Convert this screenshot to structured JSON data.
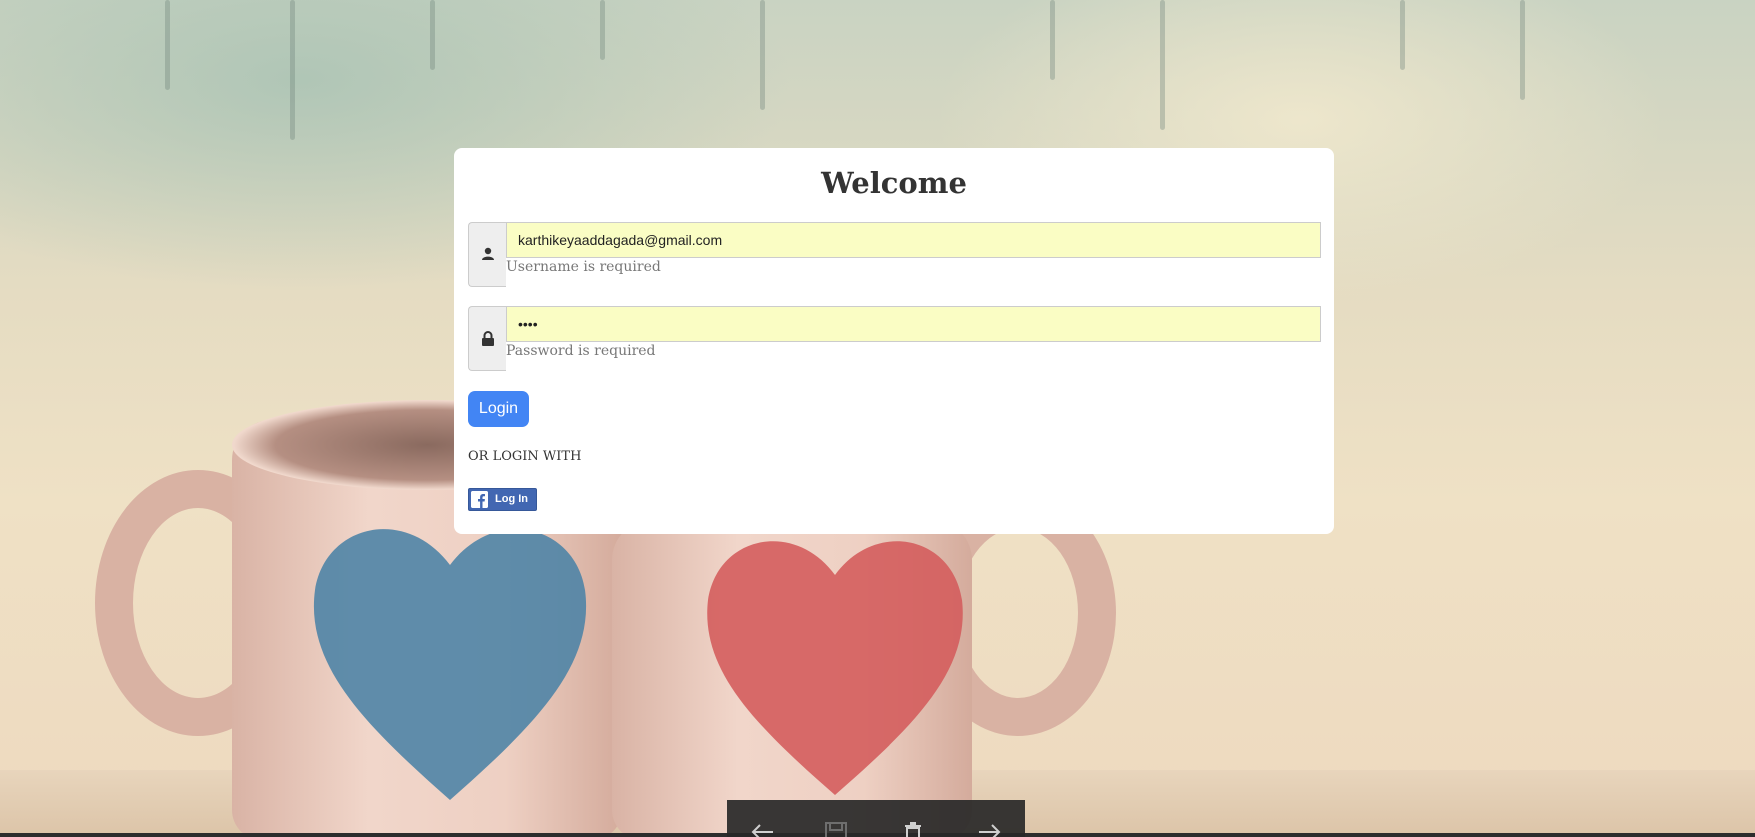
{
  "login": {
    "title": "Welcome",
    "username": {
      "value": "karthikeyaaddagada@gmail.com",
      "hint": "Username is required",
      "icon": "user-icon"
    },
    "password": {
      "value": "••••",
      "hint": "Password is required",
      "icon": "lock-icon"
    },
    "login_label": "Login",
    "or_text": "OR LOGIN WITH",
    "facebook_label": "Log In"
  },
  "viewer_toolbar": {
    "icons": [
      "arrow-left-icon",
      "save-icon",
      "trash-icon",
      "arrow-right-icon"
    ]
  },
  "colors": {
    "accent": "#4285f4",
    "facebook": "#4267b2",
    "autofill": "#fafdc4"
  }
}
